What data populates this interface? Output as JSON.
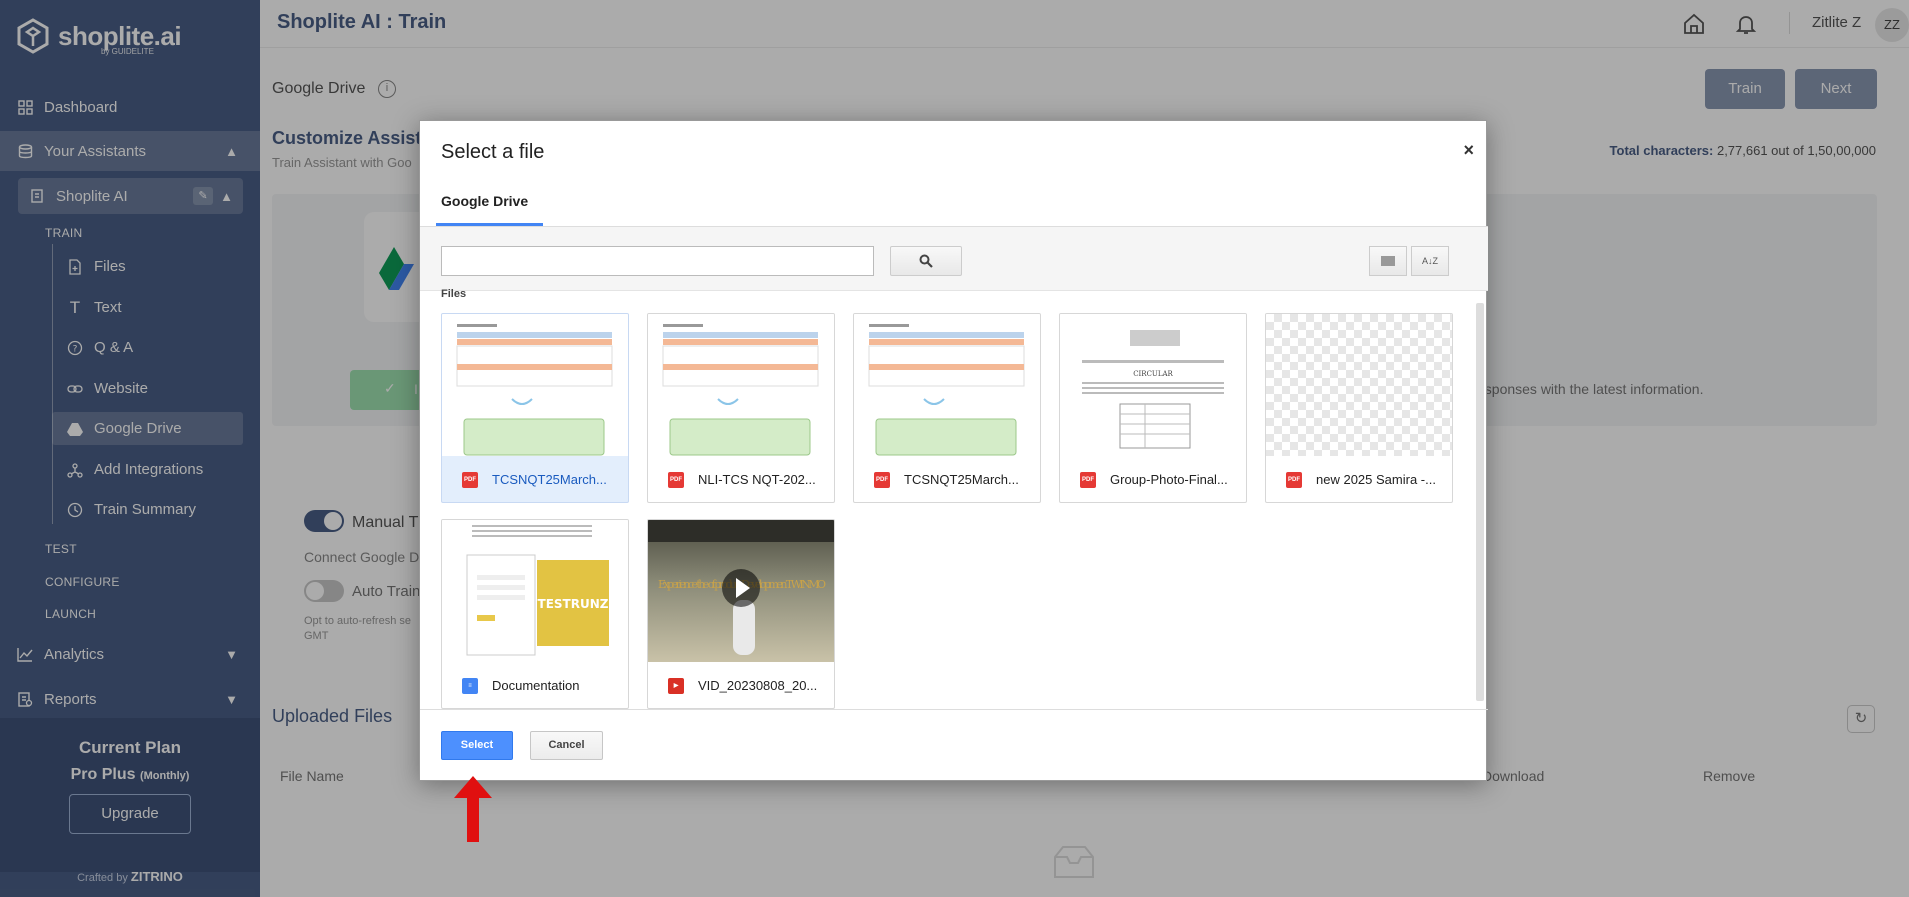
{
  "sidebar": {
    "logo_text": "shoplite.ai",
    "logo_sub": "by GUIDELITE",
    "items": [
      {
        "label": "Dashboard"
      },
      {
        "label": "Your Assistants"
      },
      {
        "label": "Shoplite AI"
      }
    ],
    "train_label": "TRAIN",
    "train_items": [
      {
        "label": "Files"
      },
      {
        "label": "Text"
      },
      {
        "label": "Q & A"
      },
      {
        "label": "Website"
      },
      {
        "label": "Google Drive"
      },
      {
        "label": "Add Integrations"
      },
      {
        "label": "Train Summary"
      }
    ],
    "test_label": "TEST",
    "configure_label": "CONFIGURE",
    "launch_label": "LAUNCH",
    "analytics_label": "Analytics",
    "reports_label": "Reports",
    "plan": {
      "title": "Current Plan",
      "name": "Pro Plus",
      "period": "(Monthly)",
      "upgrade_label": "Upgrade"
    },
    "crafted_prefix": "Crafted by",
    "crafted_brand": "ZITRINO"
  },
  "header": {
    "title": "Shoplite AI : Train",
    "user_name": "Zitlite Z",
    "user_initials": "ZZ"
  },
  "page": {
    "section_label": "Google Drive",
    "train_btn": "Train",
    "next_btn": "Next",
    "customize_title": "Customize Assista",
    "customize_sub": "Train Assistant with Goo",
    "total_chars_label": "Total characters:",
    "total_chars_value": "2,77,661 out of 1,50,00,000",
    "card_text": "esponses with the latest information.",
    "green_btn_label": "I",
    "manual_label": "Manual T",
    "connect_text": "Connect Google D",
    "auto_label": "Auto Train",
    "opt_text": "Opt to auto-refresh se GMT",
    "uploaded_title": "Uploaded Files",
    "columns": [
      "File Name",
      "Download",
      "Remove"
    ]
  },
  "dialog": {
    "title": "Select a file",
    "close_label": "×",
    "tab_label": "Google Drive",
    "search_placeholder": "",
    "files_label": "Files",
    "files": [
      {
        "name": "TCSNQT25March...",
        "type": "pdf",
        "selected": true
      },
      {
        "name": "NLI-TCS NQT-202...",
        "type": "pdf",
        "selected": false
      },
      {
        "name": "TCSNQT25March...",
        "type": "pdf",
        "selected": false
      },
      {
        "name": "Group-Photo-Final...",
        "type": "pdf",
        "selected": false
      },
      {
        "name": "new 2025 Samira -...",
        "type": "pdf",
        "selected": false
      },
      {
        "name": "Documentation",
        "type": "doc",
        "selected": false
      },
      {
        "name": "VID_20230808_20...",
        "type": "video",
        "selected": false
      }
    ],
    "thumb_texts": {
      "testrunz": "TESTRUNZ",
      "video_caption": "Experience the of product Developmen TWINMO",
      "circular": "CIRCULAR"
    },
    "select_label": "Select",
    "cancel_label": "Cancel"
  },
  "colors": {
    "sidebar": "#4a5f86",
    "accent_blue": "#4d90fe",
    "arrow_red": "#e01010",
    "pdf_red": "#e53935",
    "doc_blue": "#4285f4"
  }
}
